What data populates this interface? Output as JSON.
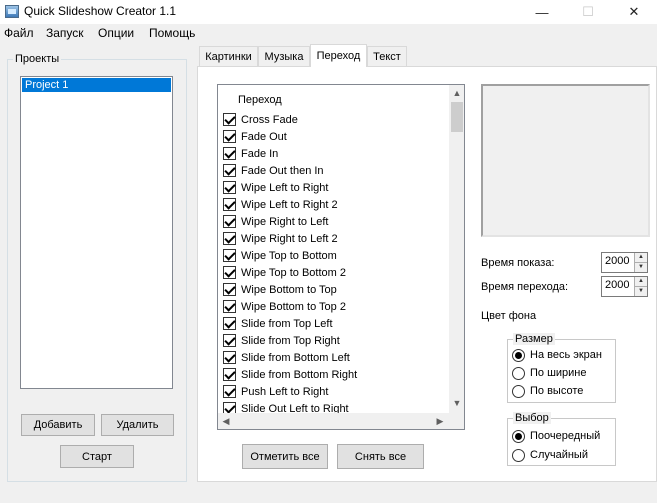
{
  "window": {
    "title": "Quick Slideshow Creator 1.1",
    "minimize_glyph": "—",
    "maximize_glyph": "☐",
    "close_glyph": "✕"
  },
  "menu": [
    "Файл",
    "Запуск",
    "Опции",
    "Помощь"
  ],
  "projects": {
    "group_title": "Проекты",
    "items": [
      "Project 1"
    ],
    "selected_index": 0,
    "add_label": "Добавить",
    "delete_label": "Удалить",
    "start_label": "Старт"
  },
  "tabs": [
    {
      "label": "Картинки",
      "active": false
    },
    {
      "label": "Музыка",
      "active": false
    },
    {
      "label": "Переход",
      "active": true
    },
    {
      "label": "Текст",
      "active": false
    }
  ],
  "transitions": {
    "header": "Переход",
    "items": [
      {
        "label": "Cross Fade",
        "checked": true
      },
      {
        "label": "Fade Out",
        "checked": true
      },
      {
        "label": "Fade In",
        "checked": true
      },
      {
        "label": "Fade Out then In",
        "checked": true
      },
      {
        "label": "Wipe Left to Right",
        "checked": true
      },
      {
        "label": "Wipe Left to Right 2",
        "checked": true
      },
      {
        "label": "Wipe Right to Left",
        "checked": true
      },
      {
        "label": "Wipe Right to Left 2",
        "checked": true
      },
      {
        "label": "Wipe Top to Bottom",
        "checked": true
      },
      {
        "label": "Wipe Top to Bottom 2",
        "checked": true
      },
      {
        "label": "Wipe Bottom to Top",
        "checked": true
      },
      {
        "label": "Wipe Bottom to Top 2",
        "checked": true
      },
      {
        "label": "Slide from Top Left",
        "checked": true
      },
      {
        "label": "Slide from Top Right",
        "checked": true
      },
      {
        "label": "Slide from Bottom Left",
        "checked": true
      },
      {
        "label": "Slide from Bottom Right",
        "checked": true
      },
      {
        "label": "Push Left to Right",
        "checked": true
      },
      {
        "label": "Slide Out Left to Right",
        "checked": true
      }
    ],
    "check_all_label": "Отметить все",
    "uncheck_all_label": "Снять все"
  },
  "settings": {
    "show_time_label": "Время показа:",
    "show_time_value": "2000",
    "transition_time_label": "Время перехода:",
    "transition_time_value": "2000",
    "bg_color_label": "Цвет фона",
    "size_group": {
      "title": "Размер",
      "options": [
        {
          "label": "На весь экран",
          "selected": true
        },
        {
          "label": "По ширине",
          "selected": false
        },
        {
          "label": "По высоте",
          "selected": false
        }
      ]
    },
    "order_group": {
      "title": "Выбор",
      "options": [
        {
          "label": "Поочередный",
          "selected": true
        },
        {
          "label": "Случайный",
          "selected": false
        }
      ]
    }
  },
  "icons": {
    "app": "slideshow-app-icon",
    "scroll_up": "▲",
    "scroll_down": "▼",
    "scroll_left": "◀",
    "scroll_right": "▶"
  },
  "colors": {
    "selection": "#0078d7",
    "window_bg": "#f0f0f0"
  }
}
